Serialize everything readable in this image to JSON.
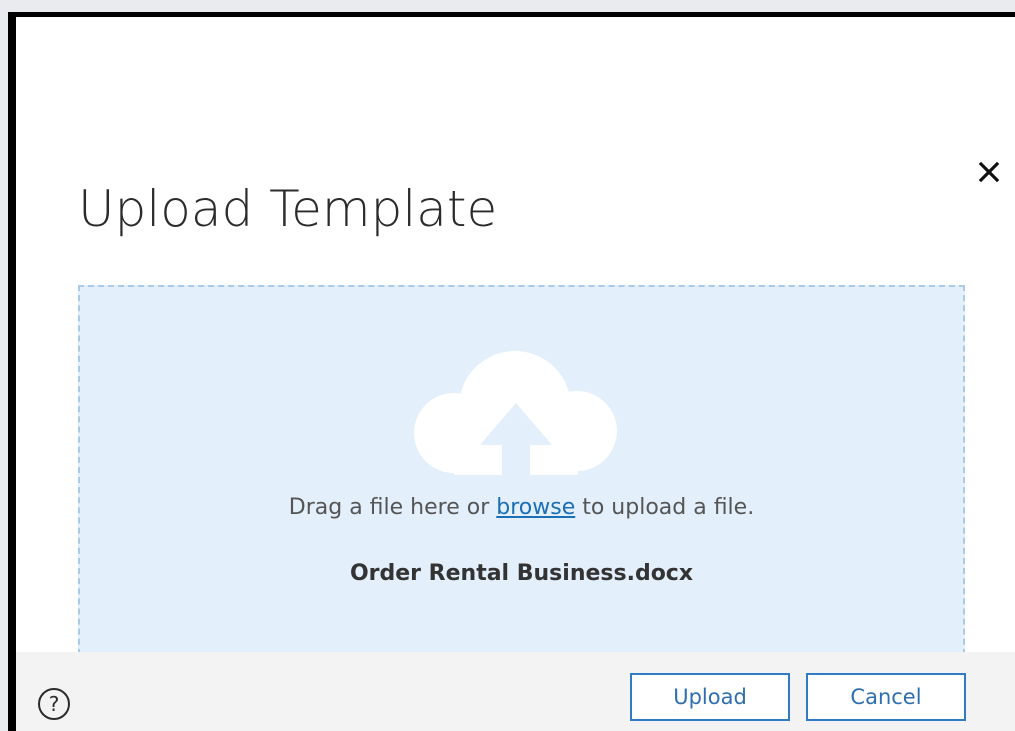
{
  "dialog": {
    "title": "Upload Template",
    "close_icon": "close-icon"
  },
  "dropzone": {
    "icon": "cloud-upload-icon",
    "text_before": "Drag a file here or ",
    "browse_link": "browse",
    "text_after": " to upload a file.",
    "file_name": "Order Rental Business.docx",
    "colors": {
      "background": "#e3effa",
      "border": "#a9cbe8",
      "link": "#1a6fb5"
    }
  },
  "footer": {
    "help_icon": "help-icon",
    "help_glyph": "?",
    "upload_label": "Upload",
    "cancel_label": "Cancel",
    "button_border_color": "#2f7cc4"
  }
}
